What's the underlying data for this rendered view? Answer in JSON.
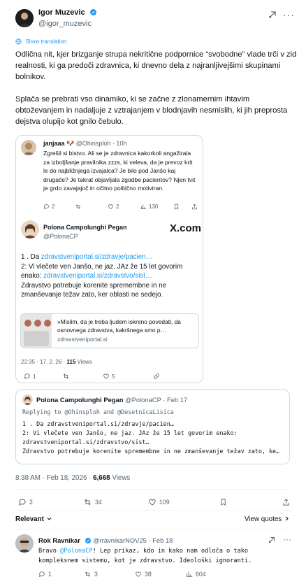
{
  "author": {
    "name": "Igor Muzevic",
    "handle": "@igor_muzevic"
  },
  "show_translation": "Show translation",
  "post_text": [
    "Odlična nit, kjer brizganje strupa nekritične podpornice “svobodne” vlade trči v zid realnosti, ki ga predoči zdravnica, ki dnevno dela z najranljivejšimi skupinami bolnikov.",
    "Splača se prebrati vso dinamiko, ki se začne z zlonamernim ihtavim obtoževanjem in nadaljuje z vztrajanjem v blodnjavih nesmislih, ki jih preprosta dejstva olupijo kot gnilo čebulo."
  ],
  "quoted": {
    "inner": {
      "name": "janjaaa 🐶",
      "handle": "@Ohinsploh",
      "time": "· 10h",
      "text": "Zgrešil si bistvo. Ali se je zdravnica kakorkoli angažirala za izboljšanje pravilnika zzzs, ki veleva, da je prevoz krit le do najbližnjega izvajalca? Je bilo pod Janšo kaj drugače? Je takrat objavljala zgodbe pacientov? Njen tvit je grdo zavajajoč in očitno politično motiviran.",
      "stats": {
        "replies": "2",
        "retweets": "",
        "likes": "2",
        "views": "130"
      }
    },
    "main": {
      "name": "Polona Campolunghi Pegan",
      "handle": "@PolonaCP",
      "badge": "X.com",
      "line1_prefix": "1 . Da ",
      "line1_link": "zdravstveniportal.si/zdravje/pacien…",
      "line2_prefix": "2: Vi vlečete ven Janšo, ne jaz. JAz že 15 let govorim enako: ",
      "line2_link": "zdravstveniportal.si/zdravstvo/sist…",
      "line3": "Zdravstvo potrebuje korenite spremembne in ne zmanševanje težav  zato, ker oblasti ne sedejo.",
      "article_title": "»Mislim, da je treba ljudem iskreno povedati, da osnovnega zdravstva, kakršnega smo p…",
      "article_domain": "zdravstveniportal.si",
      "timestamp": "22:35 · 17. 2. 26 · ",
      "views_count": "115",
      "views_label": " Views",
      "stats": {
        "replies": "1",
        "retweets": "",
        "likes": "5"
      }
    }
  },
  "quoted2": {
    "name": "Polona Campolunghi Pegan",
    "handle_time": "@PolonaCP · Feb 17",
    "replying_to": "Replying to @Ohinsploh and @DesetnicaLisica",
    "lines": [
      "1 . Da zdravstveniportal.si/zdravje/pacien…",
      "2: Vi vlečete ven Janšo, ne jaz. JAz že 15 let govorim enako:",
      "zdravstveniportal.si/zdravstvo/sist…",
      "Zdravstvo potrebuje korenite spremembne in ne zmanševanje težav  zato, ke…"
    ]
  },
  "post_meta": {
    "time": "8:38 AM · Feb 18, 2026 · ",
    "views": "6,668",
    "views_label": " Views"
  },
  "actions": {
    "replies": "2",
    "retweets": "34",
    "likes": "109",
    "views": ""
  },
  "relevant_label": "Relevant",
  "view_quotes_label": "View quotes",
  "reply": {
    "name": "Rok Ravnikar",
    "handle_time": "@rravnikarNOV25 · Feb 18",
    "text_prefix": "Bravo ",
    "mention": "@PolonaCP",
    "text_rest": "! Lep prikaz, kdo in kako nam odloča o tako kompleksnem sistemu, kot je zdravstvo. Ideološki ignoranti.",
    "stats": {
      "replies": "1",
      "retweets": "3",
      "likes": "38",
      "views": "604"
    }
  },
  "colors": {
    "accent": "#1d9bf0",
    "muted": "#536471",
    "text": "#0f1419",
    "border": "#cfd9de"
  },
  "icons": [
    "verified-badge-icon",
    "grok-icon",
    "more-icon",
    "translate-icon",
    "reply-icon",
    "retweet-icon",
    "like-icon",
    "views-icon",
    "bookmark-icon",
    "share-icon",
    "chevron-down-icon"
  ]
}
